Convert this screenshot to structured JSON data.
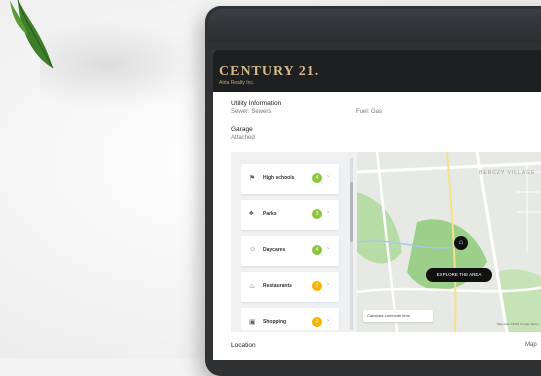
{
  "brand": {
    "name": "CENTURY 21.",
    "office": "Atria Realty Inc."
  },
  "utility": {
    "heading": "Utility Information",
    "sewer": "Sewer: Sewers",
    "fuel": "Fuel: Gas"
  },
  "garage": {
    "heading": "Garage",
    "value": "Attached"
  },
  "amenities": [
    {
      "label": "High schools",
      "count": "4",
      "icon": "school-icon",
      "color": "#8cc63f"
    },
    {
      "label": "Parks",
      "count": "3",
      "icon": "park-icon",
      "color": "#8cc63f"
    },
    {
      "label": "Daycares",
      "count": "4",
      "icon": "daycare-icon",
      "color": "#8cc63f"
    },
    {
      "label": "Restaurants",
      "count": "2",
      "icon": "restaurant-icon",
      "color": "#f4b400"
    },
    {
      "label": "Shopping",
      "count": "2",
      "icon": "shopping-icon",
      "color": "#f4b400"
    }
  ],
  "map": {
    "area_label": "BERCZY VILLAGE",
    "explore_label": "EXPLORE THE AREA",
    "commute_placeholder": "Calculate commute time",
    "footer_text": "Map data ©2024 Google  Terms"
  },
  "location": {
    "heading": "Location",
    "map_link": "Map"
  }
}
